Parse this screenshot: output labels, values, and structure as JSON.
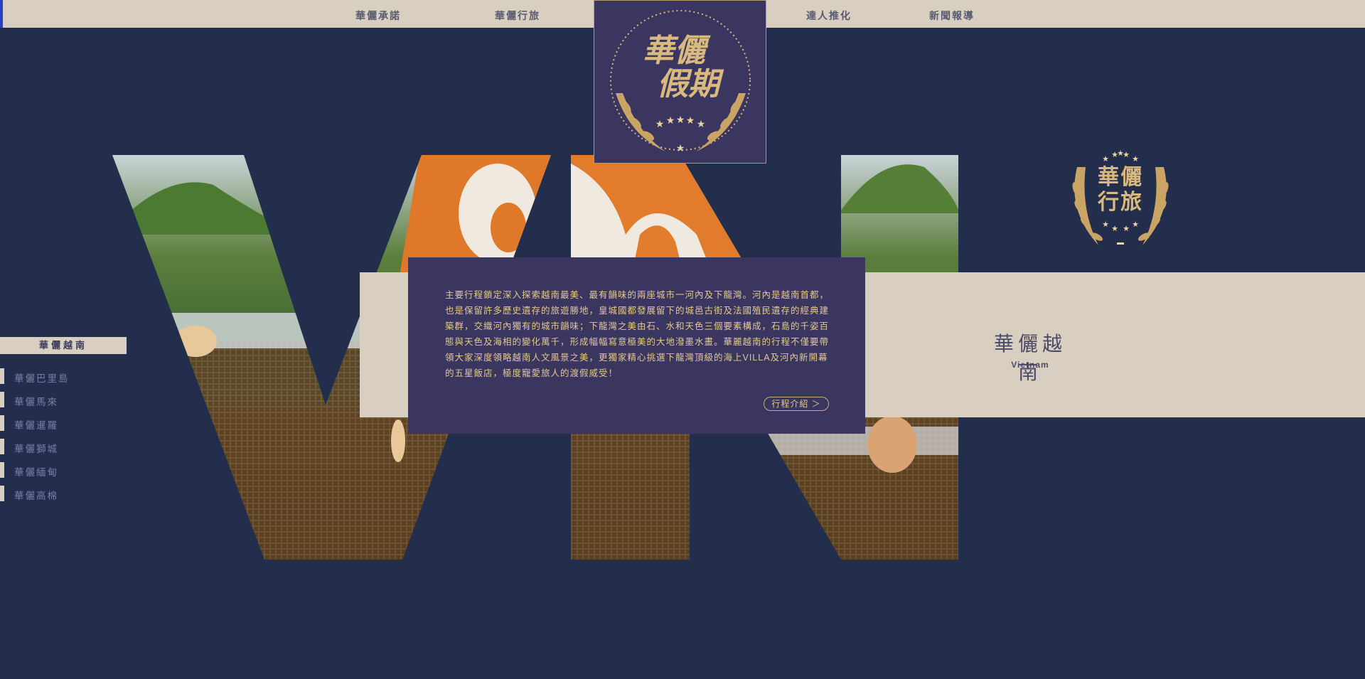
{
  "nav": {
    "items": [
      "華儷承諾",
      "華儷行旅",
      "達人推化",
      "新聞報導"
    ]
  },
  "logo": {
    "line1": "華儷",
    "line2": "假期"
  },
  "hero": {
    "description": "主要行程鎖定深入探索越南最美、最有韻味的兩座城市一河內及下龍灣。河內是越南首都，也是保留許多歷史遺存的旅遊勝地，皇城國都發展留下的城邑古街及法國殖民遺存的經典建築群，交織河內獨有的城市韻味；下龍灣之美由石、水和天色三個要素構成，石島的千姿百態與天色及海相的變化萬千，形成幅幅寫意極美的大地潑墨水畫。華麗越南的行程不僅要帶領大家深度領略越南人文風景之美，更獨家精心挑選下龍灣頂級的海上VILLA及河內新開幕的五星飯店，極度寵愛旅人的渡假威受！",
    "button": "行程介紹 ＞",
    "region_title": "華儷越南",
    "region_subtitle": "Vietnam"
  },
  "emblem": {
    "line1": "華儷",
    "line2": "行旅"
  },
  "sidebar": {
    "active": "華儷越南",
    "items": [
      "華儷巴里島",
      "華儷馬來",
      "華儷暹羅",
      "華儷獅城",
      "華儷緬甸",
      "華儷高棉"
    ]
  },
  "colors": {
    "background": "#232d4c",
    "beige": "#d8cfc0",
    "purple": "#3b3660",
    "gold": "#d9b97e"
  }
}
